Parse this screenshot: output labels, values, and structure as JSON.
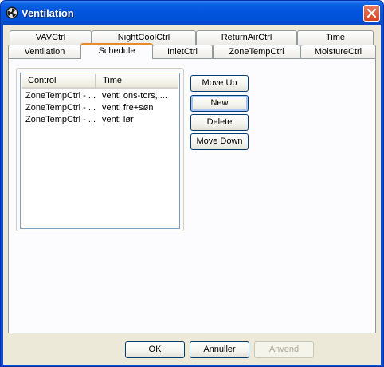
{
  "window": {
    "title": "Ventilation"
  },
  "tabs_row1": [
    "VAVCtrl",
    "NightCoolCtrl",
    "ReturnAirCtrl",
    "Time"
  ],
  "tabs_row2": [
    "Ventilation",
    "Schedule",
    "InletCtrl",
    "ZoneTempCtrl",
    "MoistureCtrl"
  ],
  "selected_tab": "Schedule",
  "list": {
    "columns": [
      "Control",
      "Time"
    ],
    "rows": [
      {
        "control": "ZoneTempCtrl - ...",
        "time": "vent: ons-tors, ..."
      },
      {
        "control": "ZoneTempCtrl - ...",
        "time": "vent: fre+søn"
      },
      {
        "control": "ZoneTempCtrl - ...",
        "time": "vent: lør"
      }
    ]
  },
  "side_buttons": {
    "move_up": "Move Up",
    "new": "New",
    "delete": "Delete",
    "move_down": "Move Down"
  },
  "footer_buttons": {
    "ok": "OK",
    "cancel": "Annuller",
    "apply": "Anvend"
  }
}
